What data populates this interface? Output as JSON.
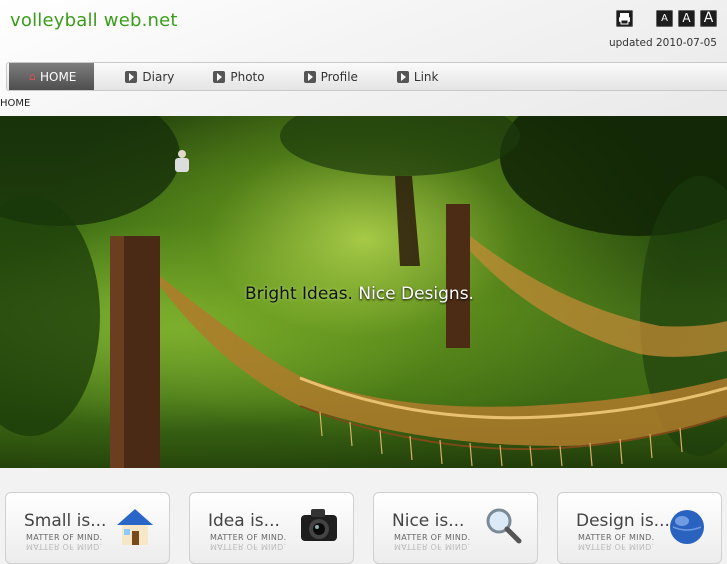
{
  "site": {
    "title": "volleyball web.net",
    "updated": "updated 2010-07-05"
  },
  "tools": {
    "print_icon": "printer-icon",
    "font_small": "A",
    "font_medium": "A",
    "font_large": "A"
  },
  "nav": {
    "items": [
      {
        "label": "HOME",
        "icon": "home-icon",
        "active": true
      },
      {
        "label": "Diary",
        "icon": "play-arrow-icon"
      },
      {
        "label": "Photo",
        "icon": "play-arrow-icon"
      },
      {
        "label": "Profile",
        "icon": "play-arrow-icon"
      },
      {
        "label": "Link",
        "icon": "play-arrow-icon"
      }
    ]
  },
  "breadcrumb": "HOME",
  "hero": {
    "tagline_part1": "Bright Ideas.",
    "tagline_part2": "Nice Designs."
  },
  "boxes": [
    {
      "title": "Small is...",
      "subtitle": "MATTER OF MIND.",
      "icon": "house-icon"
    },
    {
      "title": "Idea is...",
      "subtitle": "MATTER OF MIND.",
      "icon": "camera-icon"
    },
    {
      "title": "Nice is...",
      "subtitle": "MATTER OF MIND.",
      "icon": "magnifier-icon"
    },
    {
      "title": "Design is...",
      "subtitle": "MATTER OF MIND.",
      "icon": "globe-icon"
    }
  ],
  "colors": {
    "title_green": "#3a9d1a",
    "nav_active": "#5e5e5e"
  }
}
